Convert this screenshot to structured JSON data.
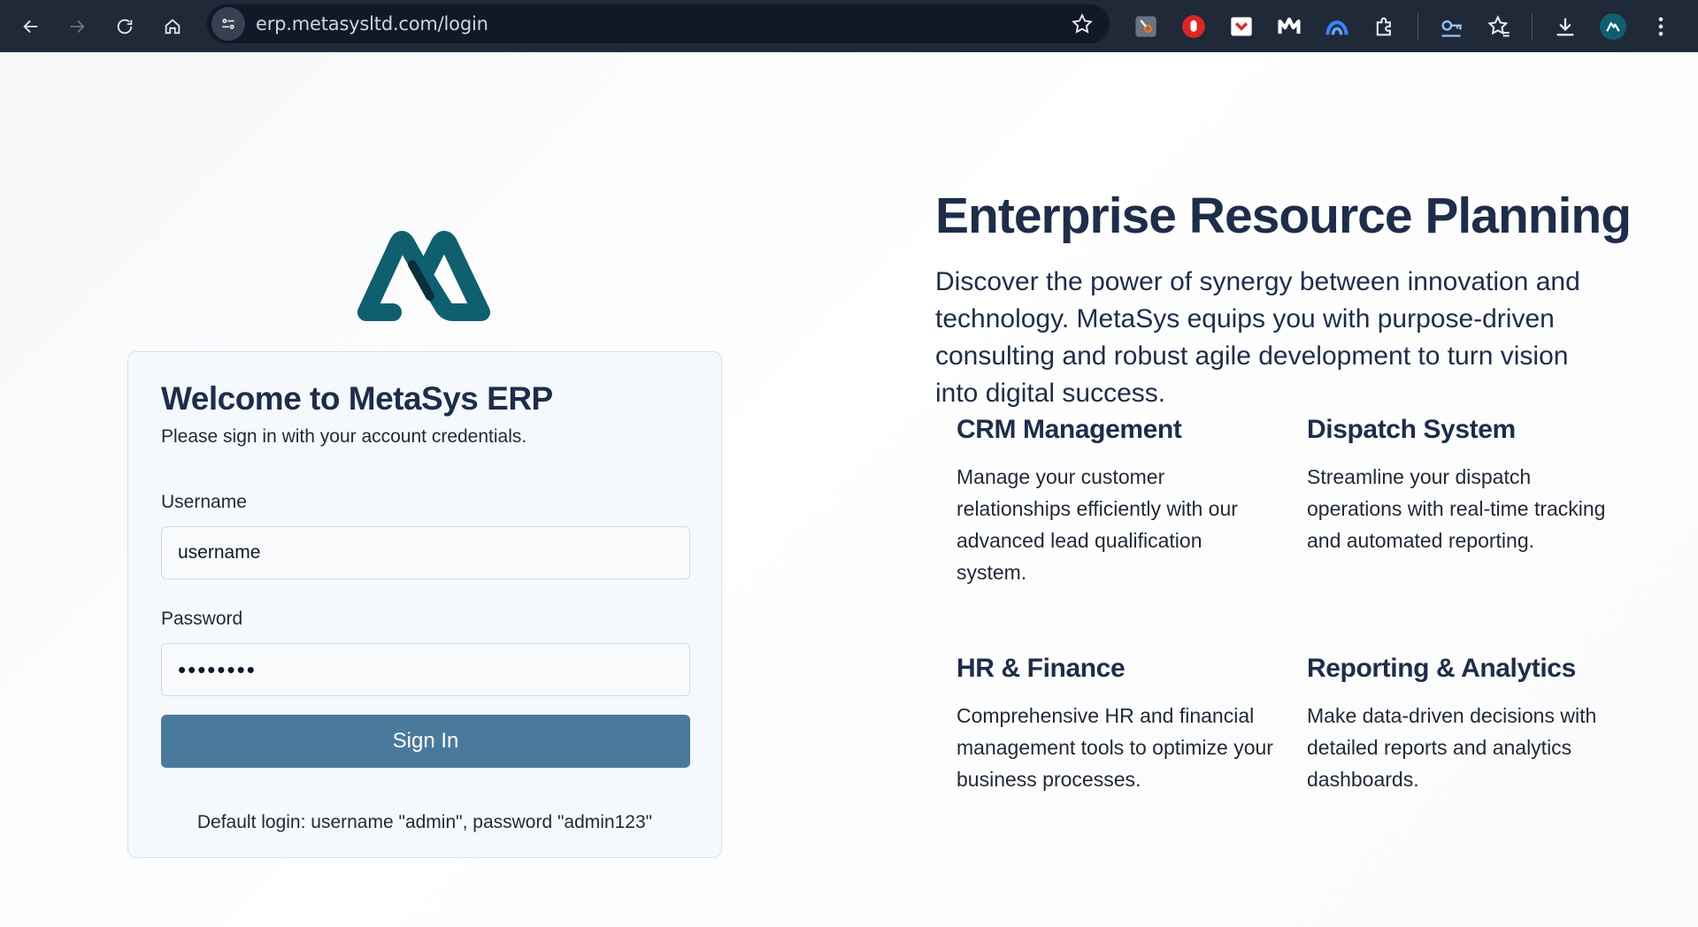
{
  "browser": {
    "url": "erp.metasysltd.com/login"
  },
  "login": {
    "title": "Welcome to MetaSys ERP",
    "subtitle": "Please sign in with your account credentials.",
    "username_label": "Username",
    "username_value": "username",
    "password_label": "Password",
    "password_value": "password",
    "signin_label": "Sign In",
    "default_login": "Default login: username \"admin\", password \"admin123\""
  },
  "hero": {
    "title": "Enterprise Resource Planning",
    "description": "Discover the power of synergy between innovation and technology. MetaSys equips you with purpose-driven consulting and robust agile development to turn vision into digital success."
  },
  "features": [
    {
      "title": "CRM Management",
      "description": "Manage your customer relationships efficiently with our advanced lead qualification system."
    },
    {
      "title": "Dispatch System",
      "description": "Streamline your dispatch operations with real-time tracking and automated reporting."
    },
    {
      "title": "HR & Finance",
      "description": "Comprehensive HR and financial management tools to optimize your business processes."
    },
    {
      "title": "Reporting & Analytics",
      "description": "Make data-driven decisions with detailed reports and analytics dashboards."
    }
  ],
  "colors": {
    "brand_teal": "#0f5f6f",
    "button": "#4a7a9b",
    "heading": "#1e2d4a"
  }
}
